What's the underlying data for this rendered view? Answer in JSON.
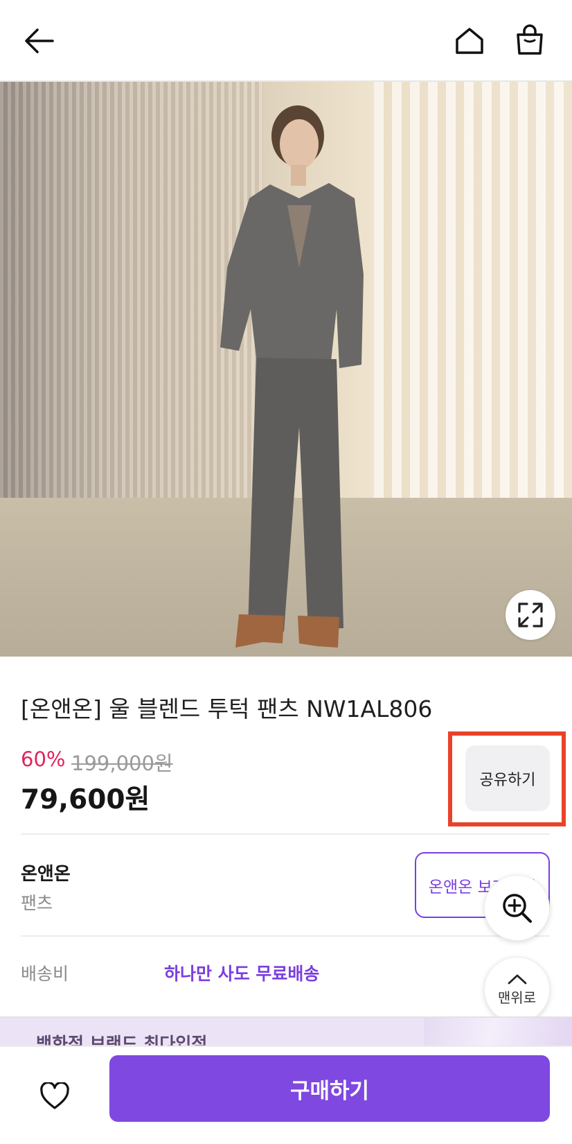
{
  "header": {
    "icons": [
      "back-arrow-icon",
      "home-icon",
      "shopping-bag-icon"
    ]
  },
  "product": {
    "title": "[온앤온] 울 블렌드 투턱 팬츠 NW1AL806",
    "discount": "60%",
    "original_price": "199,000원",
    "price": "79,600원",
    "share_label": "공유하기"
  },
  "brand": {
    "name": "온앤온",
    "category": "팬츠",
    "button_label": "온앤온 보러가기"
  },
  "shipping": {
    "label": "배송비",
    "value": "하나만 사도 무료배송"
  },
  "floating": {
    "top_label": "맨위로"
  },
  "banner": {
    "text": "백화점 브랜드 최다입점"
  },
  "bottom": {
    "buy_label": "구매하기"
  },
  "colors": {
    "accent": "#7f48e0",
    "discount": "#e0245e",
    "highlight": "#e8432a"
  }
}
